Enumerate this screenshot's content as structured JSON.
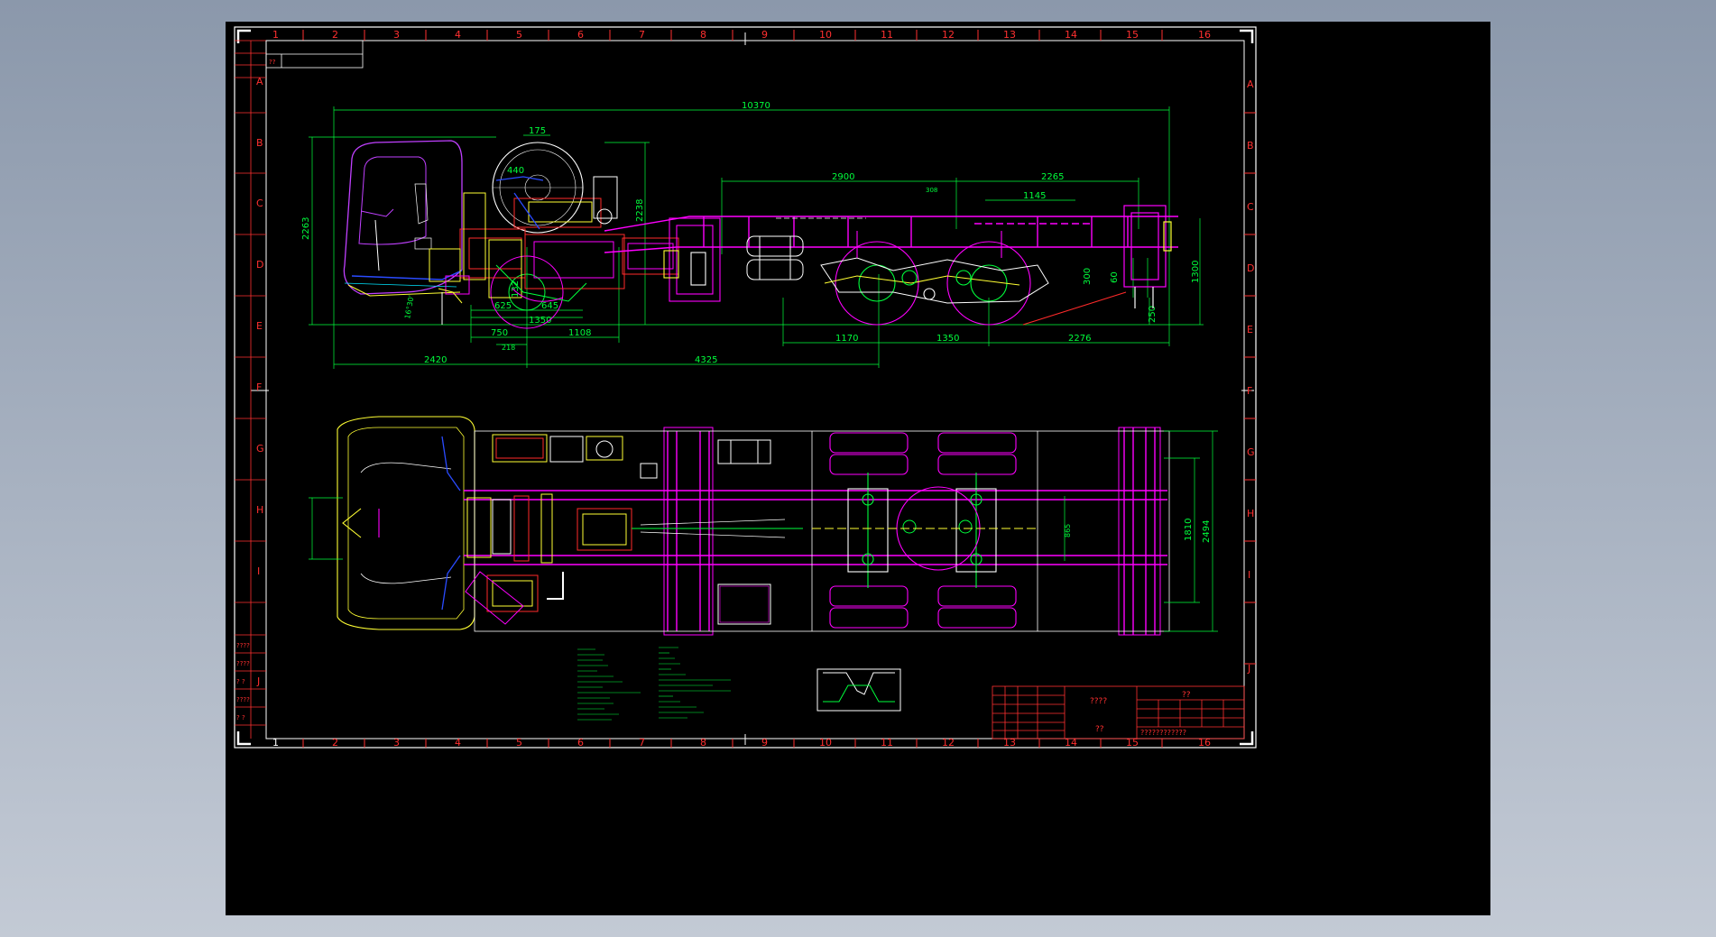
{
  "colors": {
    "background": "#000000",
    "frame": "#ffffff",
    "grid": "#ff3030",
    "dimension": "#00ff3c",
    "frame_rails": "#ff00ff",
    "cab_outline": "#c040ff",
    "engine": "#ff2a2a",
    "components": "#ffff33",
    "detail": "#ffffff",
    "cyan": "#00e5ff",
    "blue": "#2a4bff"
  },
  "grid_columns": [
    "1",
    "2",
    "3",
    "4",
    "5",
    "6",
    "7",
    "8",
    "9",
    "10",
    "11",
    "12",
    "13",
    "14",
    "15",
    "16"
  ],
  "grid_rows": [
    "A",
    "B",
    "C",
    "D",
    "E",
    "F",
    "G",
    "H",
    "I",
    "J"
  ],
  "top_left_box": {
    "label": "??"
  },
  "side_view": {
    "dim_overall": "10370",
    "dim_height": "2263",
    "dim_175": "175",
    "dim_440": "440",
    "dim_2238": "2238",
    "dim_2900": "2900",
    "dim_2265": "2265",
    "dim_1145": "1145",
    "dim_308": "308",
    "dim_1300": "1300",
    "dim_300": "300",
    "dim_60": "60",
    "dim_250": "250",
    "dim_625": "625",
    "dim_645": "645",
    "dim_1350a": "1350",
    "dim_132": "132",
    "dim_750": "750",
    "dim_218": "218",
    "dim_1108": "1108",
    "dim_2420": "2420",
    "dim_4325": "4325",
    "dim_1170": "1170",
    "dim_1350b": "1350",
    "dim_2276": "2276",
    "dim_16_30": "16°30'"
  },
  "plan_view": {
    "dim_1810": "1810",
    "dim_2494": "2494",
    "dim_865": "865"
  },
  "left_margin_labels": [
    "????",
    "????",
    "? ?",
    "????",
    "? ?"
  ],
  "title_block": {
    "title_a": "????",
    "title_b": "??",
    "title_c": "??",
    "drawing_no": "????????????"
  }
}
